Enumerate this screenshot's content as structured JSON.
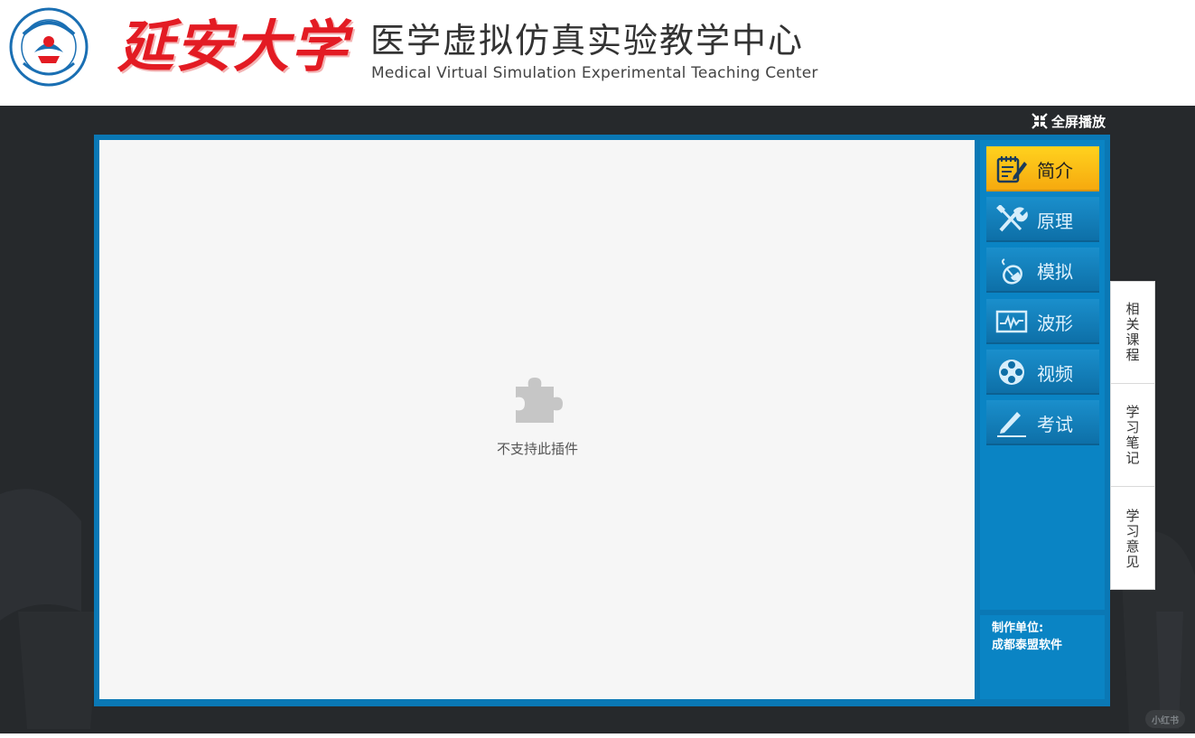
{
  "header": {
    "university_name": "延安大学",
    "center_title": "医学虚拟仿真实验教学中心",
    "center_subtitle": "Medical Virtual Simulation Experimental Teaching Center"
  },
  "toolbar": {
    "fullscreen_label": "全屏播放"
  },
  "viewer": {
    "plugin_message": "不支持此插件"
  },
  "menu": {
    "items": [
      {
        "label": "简介",
        "icon": "notepad-pen-icon",
        "active": true
      },
      {
        "label": "原理",
        "icon": "tools-icon",
        "active": false
      },
      {
        "label": "模拟",
        "icon": "mouse-icon",
        "active": false
      },
      {
        "label": "波形",
        "icon": "waveform-icon",
        "active": false
      },
      {
        "label": "视频",
        "icon": "film-reel-icon",
        "active": false
      },
      {
        "label": "考试",
        "icon": "pencil-icon",
        "active": false
      }
    ]
  },
  "credit": {
    "label": "制作单位:",
    "value": "成都泰盟软件"
  },
  "side_tabs": [
    {
      "label": "相关课程"
    },
    {
      "label": "学习笔记"
    },
    {
      "label": "学习意见"
    }
  ],
  "watermark": "小红书",
  "colors": {
    "panel_blue": "#0a78b5",
    "active_yellow": "#ffd21e",
    "stage_dark": "#26292c",
    "brand_red": "#e31b23"
  }
}
